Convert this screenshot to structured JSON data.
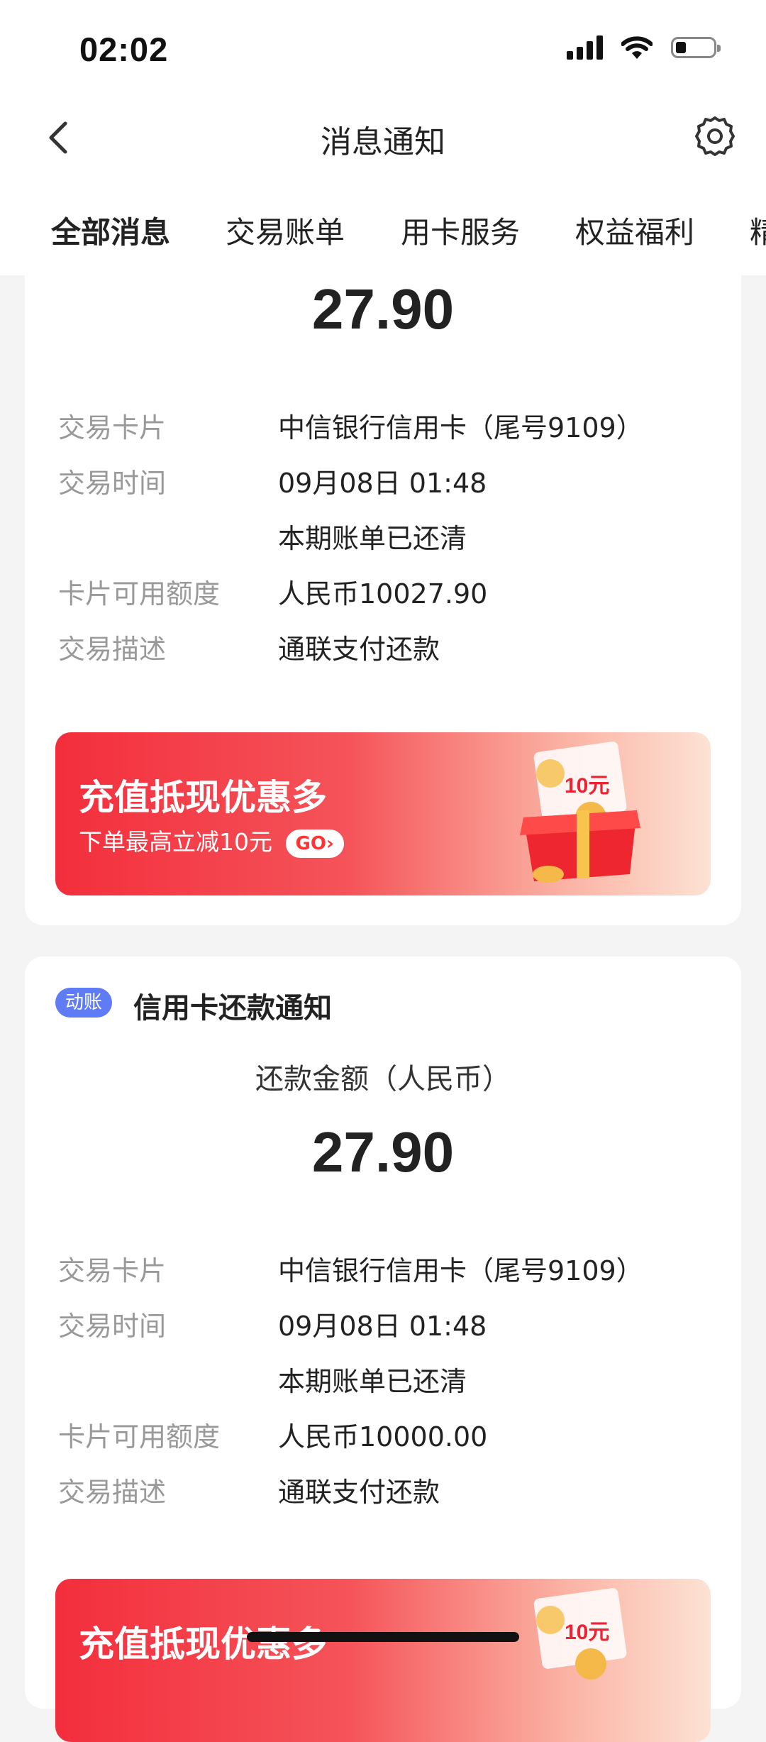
{
  "status_bar": {
    "time": "02:02"
  },
  "nav": {
    "title": "消息通知"
  },
  "tabs": [
    {
      "label": "全部消息"
    },
    {
      "label": "交易账单"
    },
    {
      "label": "用卡服务"
    },
    {
      "label": "权益福利"
    },
    {
      "label": "精"
    }
  ],
  "card1": {
    "amount": "27.90",
    "rows": [
      {
        "label": "交易卡片",
        "value": "中信银行信用卡（尾号9109）"
      },
      {
        "label": "交易时间",
        "value": "09月08日 01:48"
      },
      {
        "label": "",
        "value": "本期账单已还清"
      },
      {
        "label": "卡片可用额度",
        "value": "人民币10027.90"
      },
      {
        "label": "交易描述",
        "value": "通联支付还款"
      }
    ],
    "banner": {
      "title": "充值抵现优惠多",
      "subtitle": "下单最高立减10元",
      "go": "GO›",
      "coupon": "10元"
    }
  },
  "card2": {
    "badge": "动账",
    "heading": "信用卡还款通知",
    "amount_label": "还款金额（人民币）",
    "amount": "27.90",
    "rows": [
      {
        "label": "交易卡片",
        "value": "中信银行信用卡（尾号9109）"
      },
      {
        "label": "交易时间",
        "value": "09月08日 01:48"
      },
      {
        "label": "",
        "value": "本期账单已还清"
      },
      {
        "label": "卡片可用额度",
        "value": "人民币10000.00"
      },
      {
        "label": "交易描述",
        "value": "通联支付还款"
      }
    ],
    "banner": {
      "title": "充值抵现优惠多",
      "coupon": "10元"
    }
  },
  "colors": {
    "accent": "#ee3333",
    "badge": "#5f7cf6",
    "label_gray": "#999999"
  }
}
